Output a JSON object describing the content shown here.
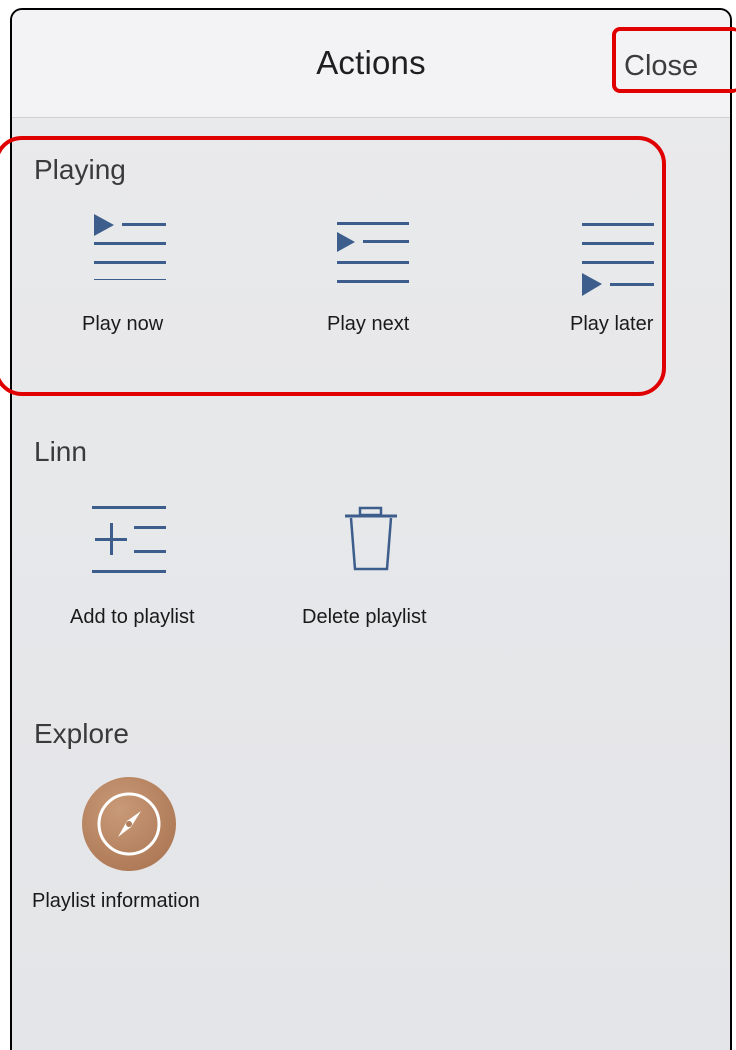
{
  "header": {
    "title": "Actions",
    "close_label": "Close"
  },
  "sections": {
    "playing": {
      "label": "Playing",
      "actions": [
        {
          "label": "Play now",
          "icon": "play-now-icon"
        },
        {
          "label": "Play next",
          "icon": "play-next-icon"
        },
        {
          "label": "Play later",
          "icon": "play-later-icon"
        }
      ]
    },
    "linn": {
      "label": "Linn",
      "actions": [
        {
          "label": "Add to playlist",
          "icon": "add-to-playlist-icon"
        },
        {
          "label": "Delete playlist",
          "icon": "trash-icon"
        }
      ]
    },
    "explore": {
      "label": "Explore",
      "actions": [
        {
          "label": "Playlist information",
          "icon": "compass-icon"
        }
      ]
    }
  },
  "colors": {
    "icon_blue": "#3d5e8c",
    "compass_brown": "#b07c59",
    "annotation_red": "#e00000"
  }
}
